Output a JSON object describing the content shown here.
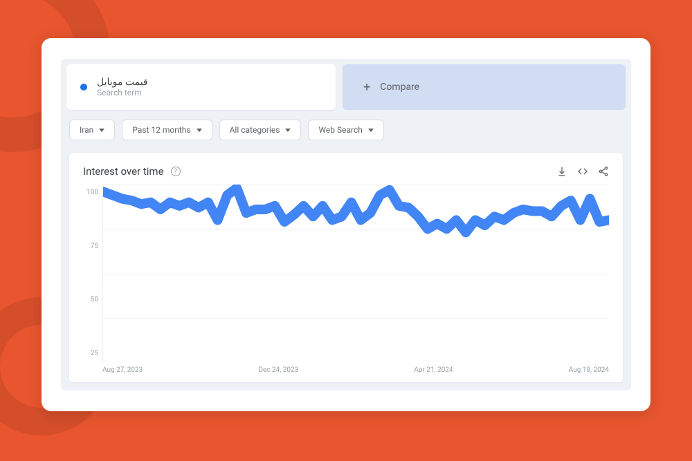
{
  "search_term": {
    "title": "قیمت موبایل",
    "subtitle": "Search term"
  },
  "compare": {
    "label": "Compare"
  },
  "filters": {
    "region": "Iran",
    "time": "Past 12 months",
    "category": "All categories",
    "type": "Web Search"
  },
  "chart": {
    "title": "Interest over time"
  },
  "colors": {
    "accent": "#e8552e",
    "series": "#4285f4"
  },
  "chart_data": {
    "type": "line",
    "title": "Interest over time",
    "xlabel": "",
    "ylabel": "",
    "ylim": [
      0,
      100
    ],
    "y_ticks": [
      100,
      75,
      50,
      25
    ],
    "x_ticks": [
      "Aug 27, 2023",
      "Dec 24, 2023",
      "Apr 21, 2024",
      "Aug 18, 2024"
    ],
    "series": [
      {
        "name": "قیمت موبایل",
        "color": "#4285f4",
        "values": [
          96,
          94,
          92,
          91,
          89,
          90,
          86,
          90,
          88,
          90,
          87,
          90,
          80,
          94,
          98,
          84,
          86,
          86,
          88,
          79,
          83,
          88,
          82,
          88,
          80,
          82,
          90,
          80,
          84,
          94,
          97,
          88,
          87,
          82,
          75,
          78,
          75,
          80,
          73,
          80,
          77,
          82,
          80,
          84,
          86,
          85,
          85,
          82,
          88,
          91,
          80,
          92,
          79,
          80
        ]
      }
    ]
  }
}
